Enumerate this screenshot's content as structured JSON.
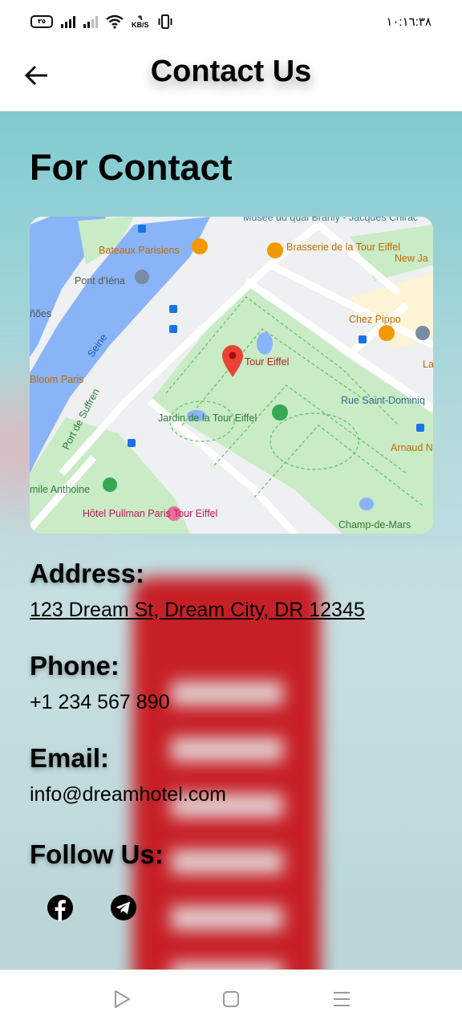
{
  "status_bar": {
    "battery": "٣٥",
    "speed_value": "٩",
    "speed_unit": "KB/S",
    "time": "١٠:١٦:٣٨"
  },
  "app_bar": {
    "title": "Contact Us",
    "back_icon": "arrow-left-icon"
  },
  "content": {
    "heading": "For Contact",
    "map": {
      "labels": [
        "Musée du quai Branly - Jacques Chirac",
        "Bateaux Parisiens",
        "Brasserie de la Tour Eiffel",
        "New Ja",
        "Pont d'Iéna",
        "ñões",
        "Chez Pippo",
        "Seine",
        "Tour Eiffel",
        "La",
        "Bloom Paris",
        "Rue Saint-Dominiq",
        "Port de Suffren",
        "Jardin de la Tour Eiffel",
        "Arnaud N",
        "mile Anthoine",
        "Hôtel Pullman Paris Tour Eiffel",
        "Champ-de-Mars"
      ]
    },
    "address_label": "Address:",
    "address_value": "123 Dream St, Dream City, DR 12345",
    "phone_label": "Phone:",
    "phone_value": "+1 234 567 890",
    "email_label": "Email:",
    "email_value": "info@dreamhotel.com",
    "follow_label": "Follow Us:",
    "social_icons": [
      "facebook-icon",
      "telegram-icon"
    ]
  },
  "nav_bar": {
    "icons": [
      "back-triangle-icon",
      "home-square-icon",
      "menu-lines-icon"
    ]
  },
  "colors": {
    "booth_red": "#c8151c",
    "map_water": "#8ab4f8",
    "map_park": "#c9ebc5",
    "pin_red": "#ea4335"
  }
}
